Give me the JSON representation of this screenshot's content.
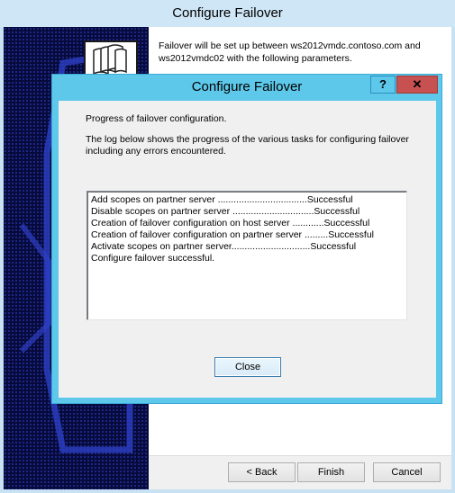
{
  "outer_window": {
    "title": "Configure Failover",
    "description": "Failover will be set up between ws2012vmdc.contoso.com and ws2012vmdc02 with the following parameters.",
    "buttons": {
      "back": "< Back",
      "finish": "Finish",
      "cancel": "Cancel"
    }
  },
  "dialog": {
    "title": "Configure Failover",
    "help_label": "?",
    "close_label": "✕",
    "heading": "Progress of failover configuration.",
    "description": "The log below shows the progress of the various tasks for configuring failover including any errors encountered.",
    "log_lines": [
      "Add scopes on partner server ..................................Successful",
      "Disable scopes on partner server ...............................Successful",
      "Creation of failover configuration on host server ............Successful",
      "Creation of failover configuration on partner server .........Successful",
      "Activate scopes on partner server..............................Successful",
      "Configure failover successful."
    ],
    "close_button": "Close"
  },
  "colors": {
    "dialog_frame": "#5dc8ea",
    "close_button_red": "#c75050",
    "banner_navy": "#070a3a"
  }
}
